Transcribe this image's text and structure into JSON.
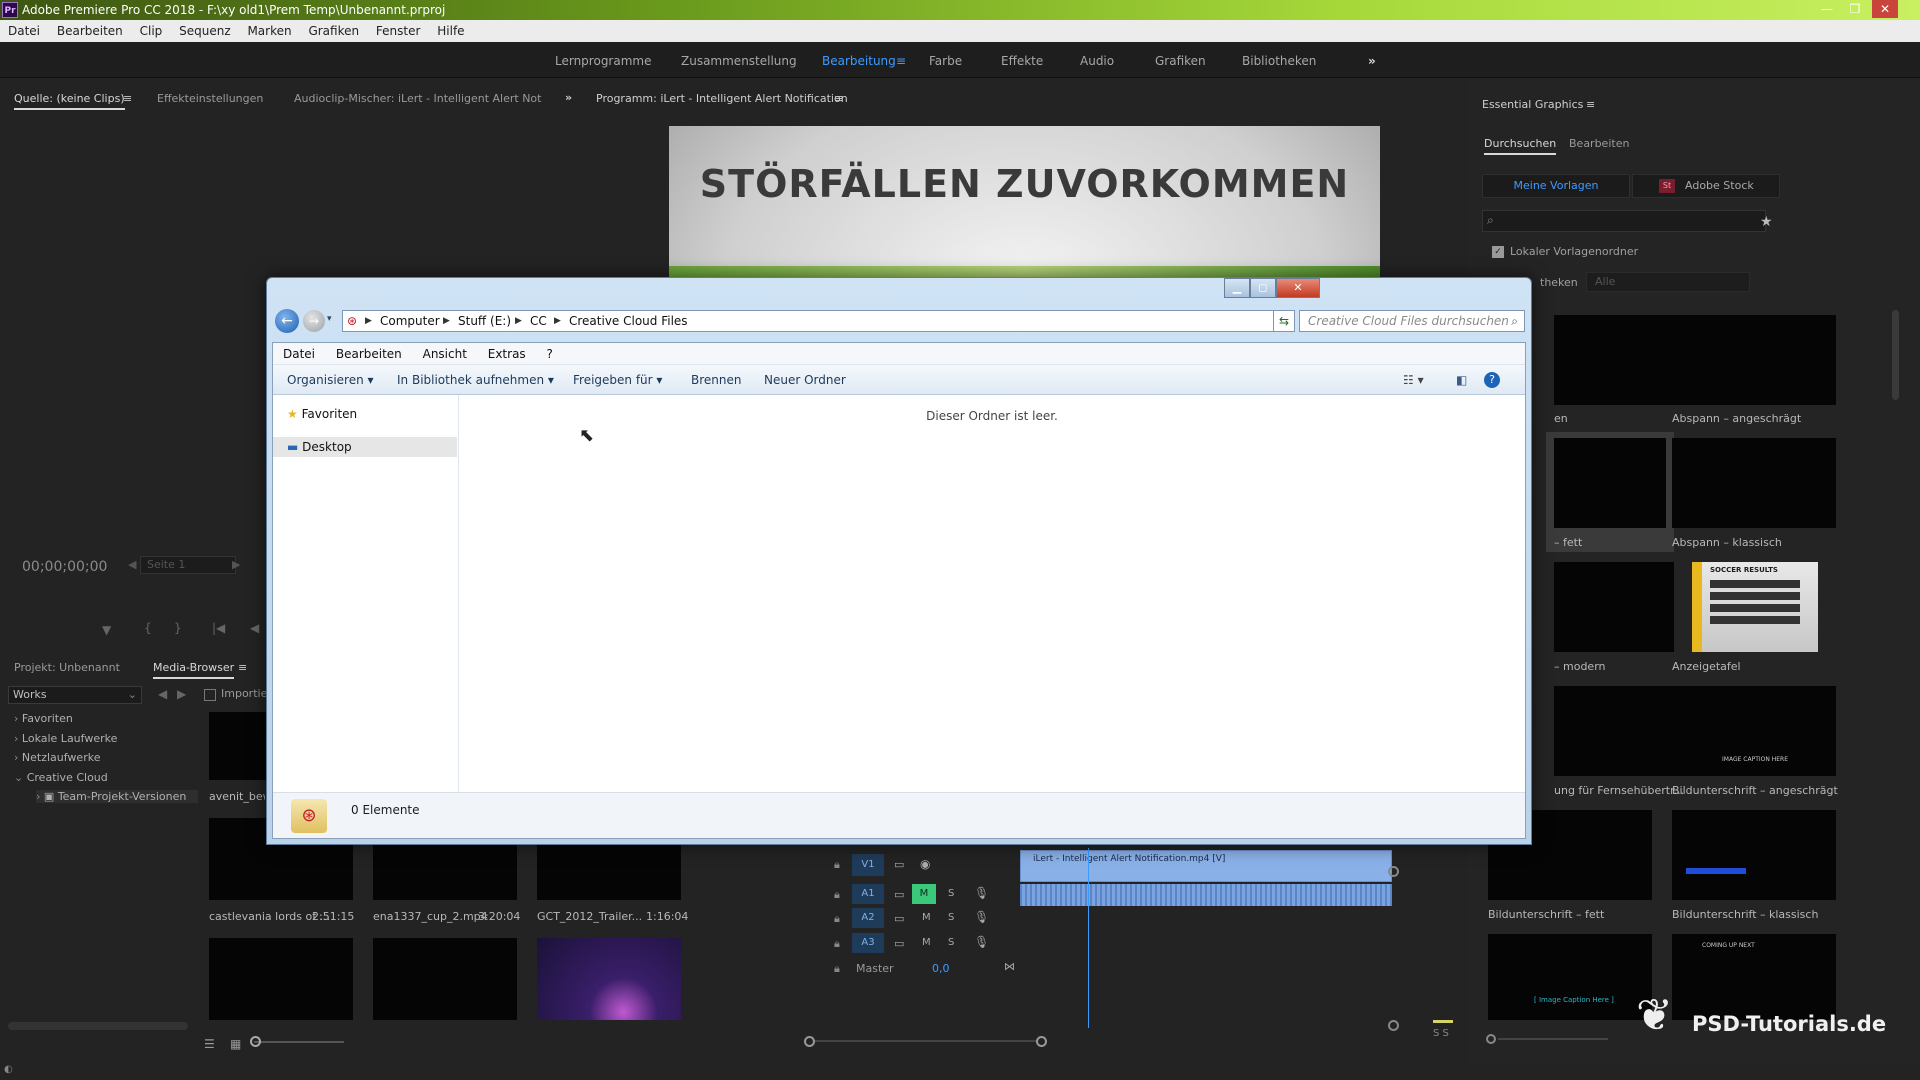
{
  "window": {
    "title": "Adobe Premiere Pro CC 2018 - F:\\xy old1\\Prem Temp\\Unbenannt.prproj",
    "app_icon": "Pr",
    "controls": [
      "—",
      "❐",
      "✕"
    ]
  },
  "menubar": [
    "Datei",
    "Bearbeiten",
    "Clip",
    "Sequenz",
    "Marken",
    "Grafiken",
    "Fenster",
    "Hilfe"
  ],
  "workspaces": [
    "Lernprogramme",
    "Zusammenstellung",
    "Bearbeitung",
    "Farbe",
    "Effekte",
    "Audio",
    "Grafiken",
    "Bibliotheken"
  ],
  "workspaces_more": "»",
  "source_panel": {
    "tabs": [
      "Quelle: (keine Clips)",
      "Effekteinstellungen",
      "Audioclip-Mischer: iLert - Intelligent Alert Notificati"
    ],
    "timecode": "00;00;00;00",
    "page": "Seite 1"
  },
  "program_panel": {
    "title": "Programm: iLert - Intelligent Alert Notification",
    "video_text": "STÖRFÄLLEN ZUVORKOMMEN"
  },
  "project_panel": {
    "tabs": [
      "Projekt: Unbenannt",
      "Media-Browser"
    ],
    "location": "Works",
    "import_label": "Importie",
    "tree": [
      "Favoriten",
      "Lokale Laufwerke",
      "Netzlaufwerke",
      "Creative Cloud",
      "Team-Projekt-Versionen"
    ],
    "clips": [
      {
        "name": "avenit_bew",
        "duration": ""
      },
      {
        "name": "castlevania lords of ...",
        "duration": "2:51:15"
      },
      {
        "name": "ena1337_cup_2.mp4",
        "duration": "3:20:04"
      },
      {
        "name": "GCT_2012_Trailer...",
        "duration": "1:16:04"
      }
    ]
  },
  "timeline": {
    "tracks": [
      {
        "name": "V1",
        "m": "",
        "s": ""
      },
      {
        "name": "A1",
        "m": "M",
        "s": "S"
      },
      {
        "name": "A2",
        "m": "M",
        "s": "S"
      },
      {
        "name": "A3",
        "m": "M",
        "s": "S"
      }
    ],
    "master": "Master",
    "master_value": "0,0",
    "clip_label": "iLert - Intelligent Alert Notification.mp4 [V]",
    "meter": "S S"
  },
  "essential_graphics": {
    "title": "Essential Graphics",
    "tabs": [
      "Durchsuchen",
      "Bearbeiten"
    ],
    "buttons": [
      "Meine Vorlagen",
      "Adobe Stock"
    ],
    "stock_badge": "St",
    "checkbox": "Lokaler Vorlagenordner",
    "libraries_label": "theken",
    "libraries_value": "Alle",
    "templates": [
      "en",
      "Abspann – angeschrägt",
      "– fett",
      "Abspann – klassisch",
      "– modern",
      "Anzeigetafel",
      "ung für Fernsehübertr...",
      "Bildunterschrift – angeschrägt",
      "Bildunterschrift – fett",
      "Bildunterschrift – klassisch"
    ],
    "thumb_texts": [
      "IMAGE CAPTION HERE",
      "[ Image Caption Here ]",
      "COMING UP NEXT",
      "SOCCER RESULTS"
    ]
  },
  "explorer": {
    "address": [
      "Computer",
      "Stuff (E:)",
      "CC",
      "Creative Cloud Files"
    ],
    "search_placeholder": "Creative Cloud Files durchsuchen",
    "menu": [
      "Datei",
      "Bearbeiten",
      "Ansicht",
      "Extras",
      "?"
    ],
    "toolbar": [
      "Organisieren ▾",
      "In Bibliothek aufnehmen ▾",
      "Freigeben für ▾",
      "Brennen",
      "Neuer Ordner"
    ],
    "nav": [
      "Favoriten",
      "Desktop"
    ],
    "empty_text": "Dieser Ordner ist leer.",
    "status": "0 Elemente"
  },
  "watermark": "PSD-Tutorials.de",
  "colors": {
    "accent": "#3d9bff",
    "titlebar": "#8cc63f",
    "explorer_frame": "#c4dbf0"
  }
}
